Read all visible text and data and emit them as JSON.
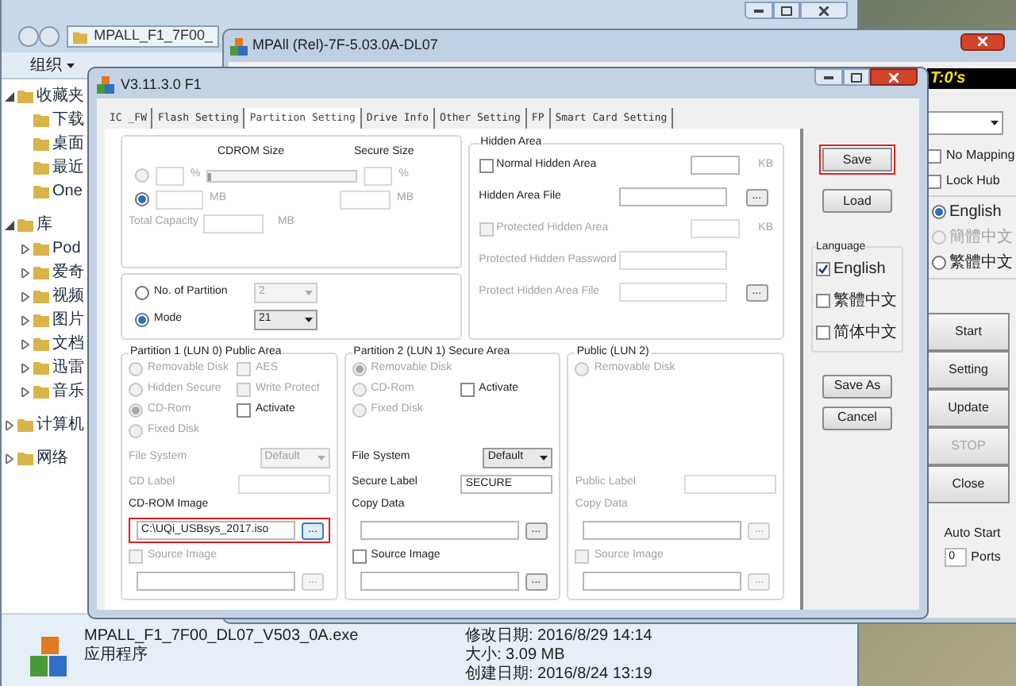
{
  "explorer": {
    "breadcrumb": "MPALL_F1_7F00_",
    "organize": "组织",
    "nav": [
      {
        "label": "收藏夹",
        "expanded": true,
        "children": [
          {
            "label": "下载"
          },
          {
            "label": "桌面"
          },
          {
            "label": "最近"
          },
          {
            "label": "One"
          }
        ]
      },
      {
        "label": "库",
        "expanded": true,
        "children": [
          {
            "label": "Pod",
            "expanded": false
          },
          {
            "label": "爱奇",
            "expanded": false
          },
          {
            "label": "视频",
            "expanded": false
          },
          {
            "label": "图片",
            "expanded": false
          },
          {
            "label": "文档",
            "expanded": false
          },
          {
            "label": "迅雷",
            "expanded": false
          },
          {
            "label": "音乐",
            "expanded": false
          }
        ]
      },
      {
        "label": "计算机",
        "expanded": false
      },
      {
        "label": "网络",
        "expanded": false
      }
    ],
    "details": {
      "name": "MPALL_F1_7F00_DL07_V503_0A.exe",
      "modified": "修改日期: 2016/8/29 14:14",
      "type": "应用程序",
      "size": "大小: 3.09 MB",
      "created": "创建日期: 2016/8/24 13:19"
    }
  },
  "mpall": {
    "title": "MPAll (Rel)-7F-5.03.0A-DL07",
    "timer": "T:0's",
    "checks": [
      {
        "label": "No Mapping",
        "checked": false
      },
      {
        "label": "Lock Hub",
        "checked": false
      }
    ],
    "languages": [
      {
        "label": "English",
        "selected": true,
        "disabled": false
      },
      {
        "label": "簡體中文",
        "selected": false,
        "disabled": true
      },
      {
        "label": "繁體中文",
        "selected": false,
        "disabled": false
      }
    ],
    "buttons": [
      {
        "label": "Start",
        "disabled": false
      },
      {
        "label": "Setting",
        "disabled": false
      },
      {
        "label": "Update",
        "disabled": false
      },
      {
        "label": "STOP",
        "disabled": true
      },
      {
        "label": "Close",
        "disabled": false
      }
    ],
    "auto_start": "Auto Start",
    "ports_value": "0",
    "ports": "Ports"
  },
  "dialog": {
    "title": "V3.11.3.0 F1",
    "tabs": [
      {
        "label": "IC _FW",
        "selected": false
      },
      {
        "label": "Flash Setting",
        "selected": false
      },
      {
        "label": "Partition Setting",
        "selected": true
      },
      {
        "label": "Drive Info",
        "selected": false
      },
      {
        "label": "Other Setting",
        "selected": false
      },
      {
        "label": "FP",
        "selected": false
      },
      {
        "label": "Smart Card Setting",
        "selected": false
      }
    ],
    "capacity": {
      "cdrom_size": "CDROM Size",
      "secure_size": "Secure Size",
      "percent_selected": false,
      "percent_unit_1": "%",
      "slider": {
        "level": 0
      },
      "percent_unit_2": "%",
      "mb_selected": true,
      "mb_unit_1": "MB",
      "mb_unit_2": "MB",
      "total_capacity": "Total Capacity",
      "total_unit": "MB"
    },
    "partition_mode": [
      {
        "label": "No. of Partition",
        "selected": false,
        "value": "2"
      },
      {
        "label": "Mode",
        "selected": true,
        "value": "21"
      }
    ],
    "hidden_area": {
      "title": "Hidden Area",
      "rows": [
        {
          "kind": "check",
          "label": "Normal Hidden Area",
          "checked": false,
          "disabled": false,
          "unit": "KB"
        },
        {
          "kind": "file",
          "label": "Hidden Area File",
          "disabled": false,
          "button": "..."
        },
        {
          "kind": "check",
          "label": "Protected Hidden Area",
          "checked": false,
          "disabled": true,
          "unit": "KB"
        },
        {
          "kind": "field",
          "label": "Protected Hidden Password",
          "disabled": true
        },
        {
          "kind": "file",
          "label": "Protect Hidden Area File",
          "disabled": true,
          "button": "..."
        }
      ]
    },
    "partitions": [
      {
        "title": "Partition 1 (LUN 0) Public Area",
        "options": [
          {
            "label": "Removable Disk",
            "selected": false,
            "disabled": true,
            "check": {
              "label": "AES",
              "checked": false,
              "disabled": true
            }
          },
          {
            "label": "Hidden Secure",
            "selected": false,
            "disabled": true,
            "check": {
              "label": "Write Protect",
              "checked": false,
              "disabled": true
            }
          },
          {
            "label": "CD-Rom",
            "selected": true,
            "disabled": true,
            "check": {
              "label": "Activate",
              "checked": false,
              "disabled": false
            }
          },
          {
            "label": "Fixed Disk",
            "selected": false,
            "disabled": true
          }
        ],
        "fields": [
          {
            "kind": "select",
            "label": "File System",
            "value": "Default",
            "disabled": true
          },
          {
            "kind": "text",
            "label": "CD Label",
            "disabled": true
          },
          {
            "kind": "label",
            "label": "CD-ROM Image",
            "disabled": false
          },
          {
            "kind": "file",
            "value": "C:\\UQi_USBsys_2017.iso",
            "button": "...",
            "disabled": false,
            "highlighted": true
          },
          {
            "kind": "check",
            "label": "Source Image",
            "checked": false,
            "disabled": true
          },
          {
            "kind": "file",
            "button": "...",
            "disabled": true,
            "highlighted": false
          }
        ]
      },
      {
        "title": "Partition 2 (LUN 1) Secure Area",
        "options": [
          {
            "label": "Removable Disk",
            "selected": true,
            "disabled": true
          },
          {
            "label": "CD-Rom",
            "selected": false,
            "disabled": true,
            "check": {
              "label": "Activate",
              "checked": false,
              "disabled": false
            }
          },
          {
            "label": "Fixed Disk",
            "selected": false,
            "disabled": true
          }
        ],
        "fields": [
          {
            "kind": "select",
            "label": "File System",
            "value": "Default",
            "disabled": false
          },
          {
            "kind": "text",
            "label": "Secure Label",
            "value": "SECURE",
            "disabled": false
          },
          {
            "kind": "label",
            "label": "Copy Data",
            "disabled": false
          },
          {
            "kind": "file",
            "button": "...",
            "disabled": false,
            "highlighted": false
          },
          {
            "kind": "check",
            "label": "Source Image",
            "checked": false,
            "disabled": false
          },
          {
            "kind": "file",
            "button": "...",
            "disabled": false,
            "highlighted": false
          }
        ]
      },
      {
        "title": "Public (LUN 2)",
        "options": [
          {
            "label": "Removable Disk",
            "selected": false,
            "disabled": true
          }
        ],
        "fields": [
          {
            "kind": "text",
            "label": "Public Label",
            "disabled": true
          },
          {
            "kind": "label",
            "label": "Copy Data",
            "disabled": true
          },
          {
            "kind": "file",
            "button": "...",
            "disabled": true,
            "highlighted": false
          },
          {
            "kind": "check",
            "label": "Source Image",
            "checked": false,
            "disabled": true
          },
          {
            "kind": "file",
            "button": "...",
            "disabled": true,
            "highlighted": false
          }
        ]
      }
    ],
    "buttons_top": [
      {
        "label": "Save",
        "highlighted": true
      },
      {
        "label": "Load",
        "highlighted": false
      }
    ],
    "language": {
      "title": "Language",
      "items": [
        {
          "label": "English",
          "checked": true
        },
        {
          "label": "繁體中文",
          "checked": false
        },
        {
          "label": "简体中文",
          "checked": false
        }
      ]
    },
    "buttons_bottom": [
      {
        "label": "Save As",
        "highlighted": false
      },
      {
        "label": "Cancel",
        "highlighted": false
      }
    ]
  }
}
